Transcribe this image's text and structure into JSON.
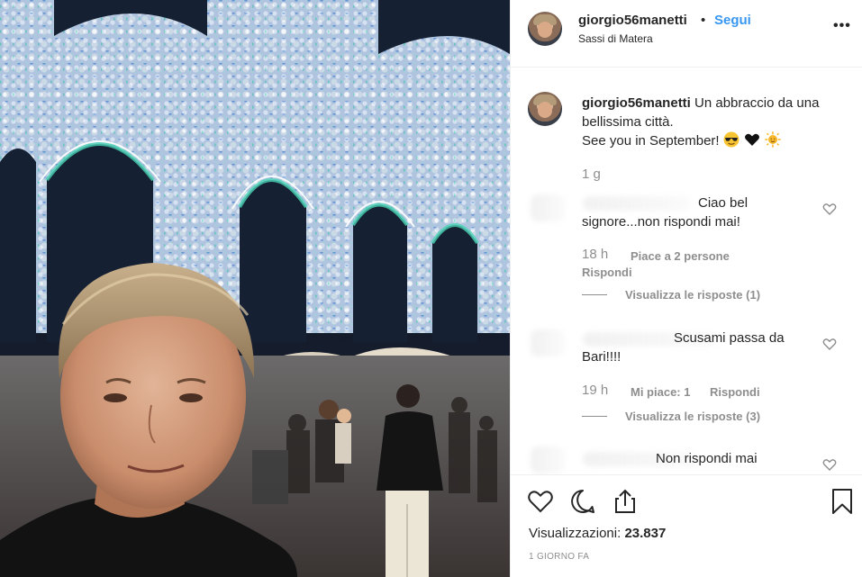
{
  "header": {
    "username": "giorgio56manetti",
    "separator": "•",
    "follow_label": "Segui",
    "location": "Sassi di Matera",
    "more_label": "•••"
  },
  "caption": {
    "username": "giorgio56manetti",
    "text": "Un abbraccio da una bellissima città.",
    "line2": "See you in September!",
    "emojis": [
      "sunglasses-emoji",
      "black-heart-emoji",
      "sun-emoji"
    ],
    "time": "1 g"
  },
  "comments": [
    {
      "text_line1": "Ciao bel",
      "text_line2": "signore...non rispondi mai!",
      "time": "18 h",
      "likes": "Piace a 2 persone",
      "reply_label": "Rispondi",
      "view_replies": "Visualizza le risposte (1)"
    },
    {
      "text_line1": "Scusami passa da",
      "text_line2": "Bari!!!!",
      "time": "19 h",
      "likes": "Mi piace: 1",
      "reply_label": "Rispondi",
      "view_replies": "Visualizza le risposte (3)"
    },
    {
      "text_line1": "Non rispondi mai"
    }
  ],
  "actions": {
    "icons": [
      "heart-icon",
      "comment-icon",
      "share-icon",
      "bookmark-icon"
    ],
    "views_label": "Visualizzazioni:",
    "views_count": "23.837",
    "posted_ago": "1 GIORNO FA"
  },
  "colors": {
    "link_blue": "#3897f0",
    "text": "#262626",
    "muted": "#8e8e8e",
    "border": "#efefef"
  }
}
